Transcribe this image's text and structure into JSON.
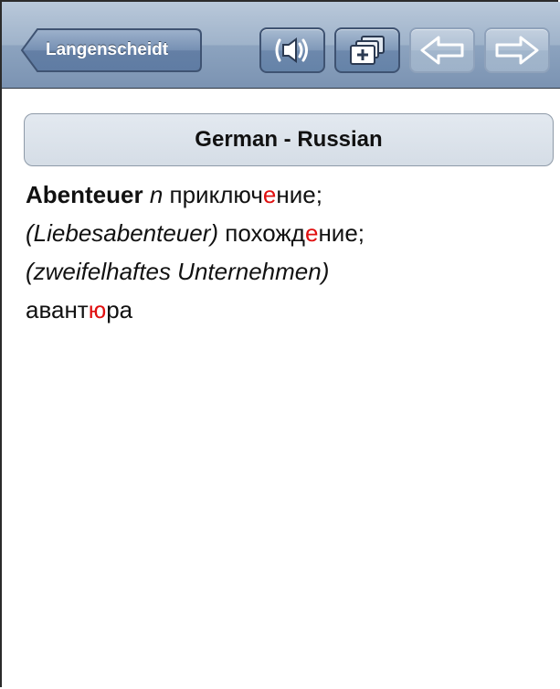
{
  "navbar": {
    "back_label": "Langenscheidt",
    "buttons": [
      {
        "icon": "speaker-icon",
        "enabled": true
      },
      {
        "icon": "add-card-icon",
        "enabled": true
      },
      {
        "icon": "arrow-left-icon",
        "enabled": false
      },
      {
        "icon": "arrow-right-icon",
        "enabled": false
      }
    ]
  },
  "header": {
    "title": "German - Russian"
  },
  "entry": {
    "headword": "Abenteuer",
    "gender": "n",
    "t1_pre": "приключ",
    "t1_stress": "е",
    "t1_post": "ние",
    "sep1": ";",
    "context1": "(Liebesabenteuer)",
    "t2_pre": "похожд",
    "t2_stress": "е",
    "t2_post": "ние",
    "sep2": ";",
    "context2": "(zweifelhaftes Unternehmen)",
    "t3_pre": "авант",
    "t3_stress": "ю",
    "t3_post": "ра"
  },
  "colors": {
    "stress": "#e01010",
    "nav_button": "#6d88ac",
    "header_bg": "#d5dde6"
  }
}
